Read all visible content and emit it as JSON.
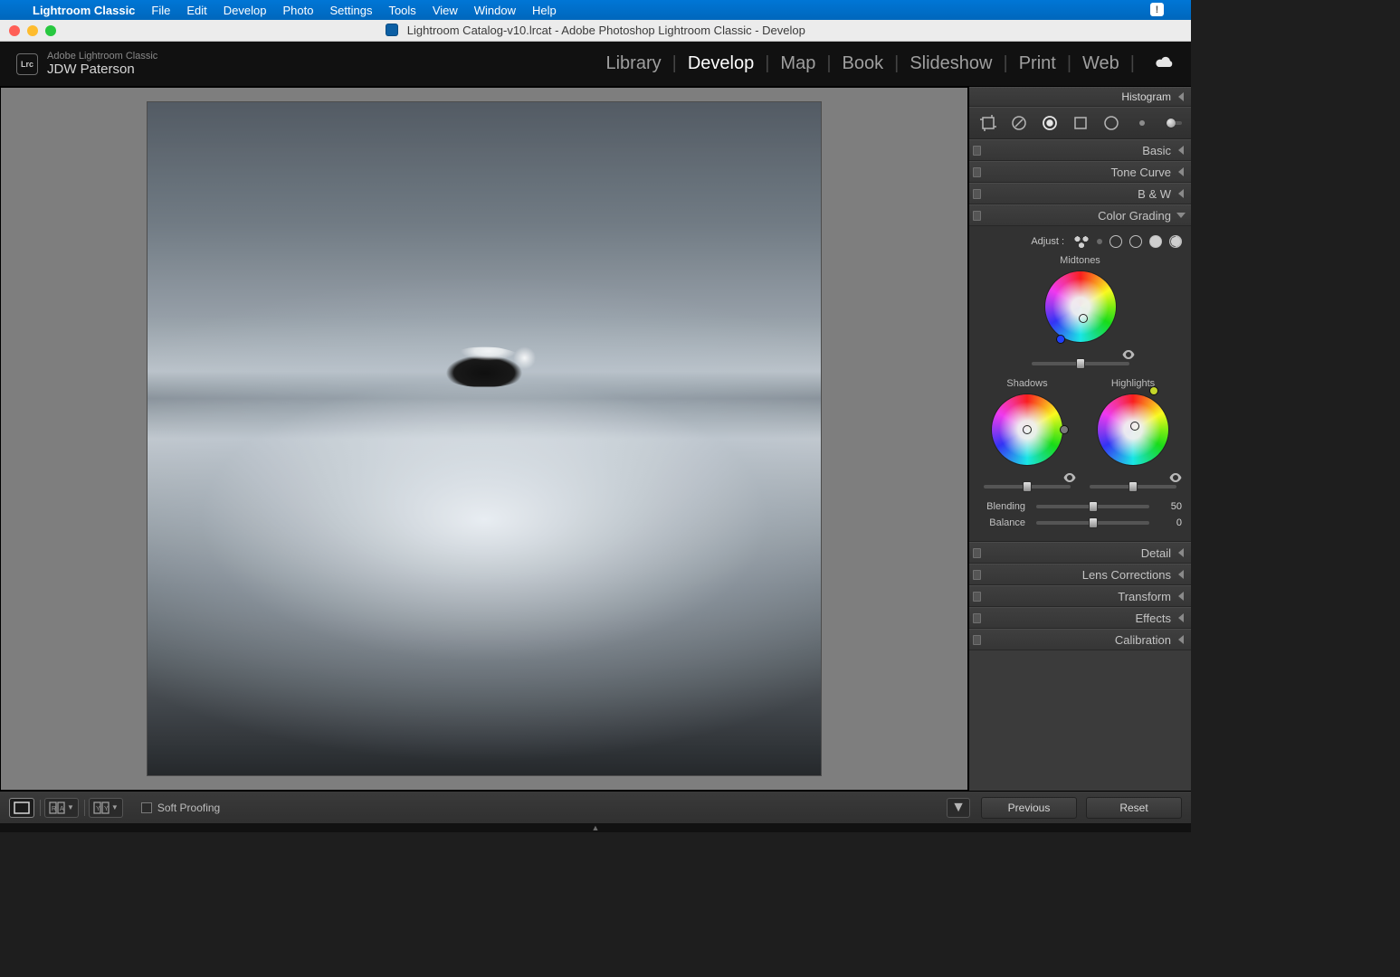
{
  "macmenu": {
    "app_name": "Lightroom Classic",
    "items": [
      "File",
      "Edit",
      "Develop",
      "Photo",
      "Settings",
      "Tools",
      "View",
      "Window",
      "Help"
    ]
  },
  "window": {
    "title": "Lightroom Catalog-v10.lrcat - Adobe Photoshop Lightroom Classic - Develop"
  },
  "identity": {
    "product_line": "Adobe Lightroom Classic",
    "user_name": "JDW Paterson",
    "logo_text": "Lrc"
  },
  "modules": {
    "items": [
      "Library",
      "Develop",
      "Map",
      "Book",
      "Slideshow",
      "Print",
      "Web"
    ],
    "active": "Develop"
  },
  "right_panels": {
    "histogram": "Histogram",
    "basic": "Basic",
    "tone_curve": "Tone Curve",
    "bw": "B & W",
    "color_grading": "Color Grading",
    "detail": "Detail",
    "lens": "Lens Corrections",
    "transform": "Transform",
    "effects": "Effects",
    "calibration": "Calibration"
  },
  "tools": {
    "crop": "crop-icon",
    "heal": "spot-heal-icon",
    "redeye": "red-eye-icon",
    "grad": "graduated-filter-icon",
    "radial": "radial-filter-icon",
    "brush": "adjustment-brush-icon"
  },
  "color_grading": {
    "adjust_label": "Adjust :",
    "midtones_label": "Midtones",
    "shadows_label": "Shadows",
    "highlights_label": "Highlights",
    "blending_label": "Blending",
    "blending_value": "50",
    "balance_label": "Balance",
    "balance_value": "0",
    "midtones": {
      "hue_deg": 227,
      "sat_pct": 18,
      "lum_pct": 50
    },
    "shadows": {
      "hue_deg": 0,
      "sat_pct": 0,
      "lum_pct": 50
    },
    "highlights": {
      "hue_deg": 72,
      "sat_pct": 8,
      "lum_pct": 50
    }
  },
  "bottom": {
    "soft_proofing": "Soft Proofing",
    "previous": "Previous",
    "reset": "Reset"
  }
}
